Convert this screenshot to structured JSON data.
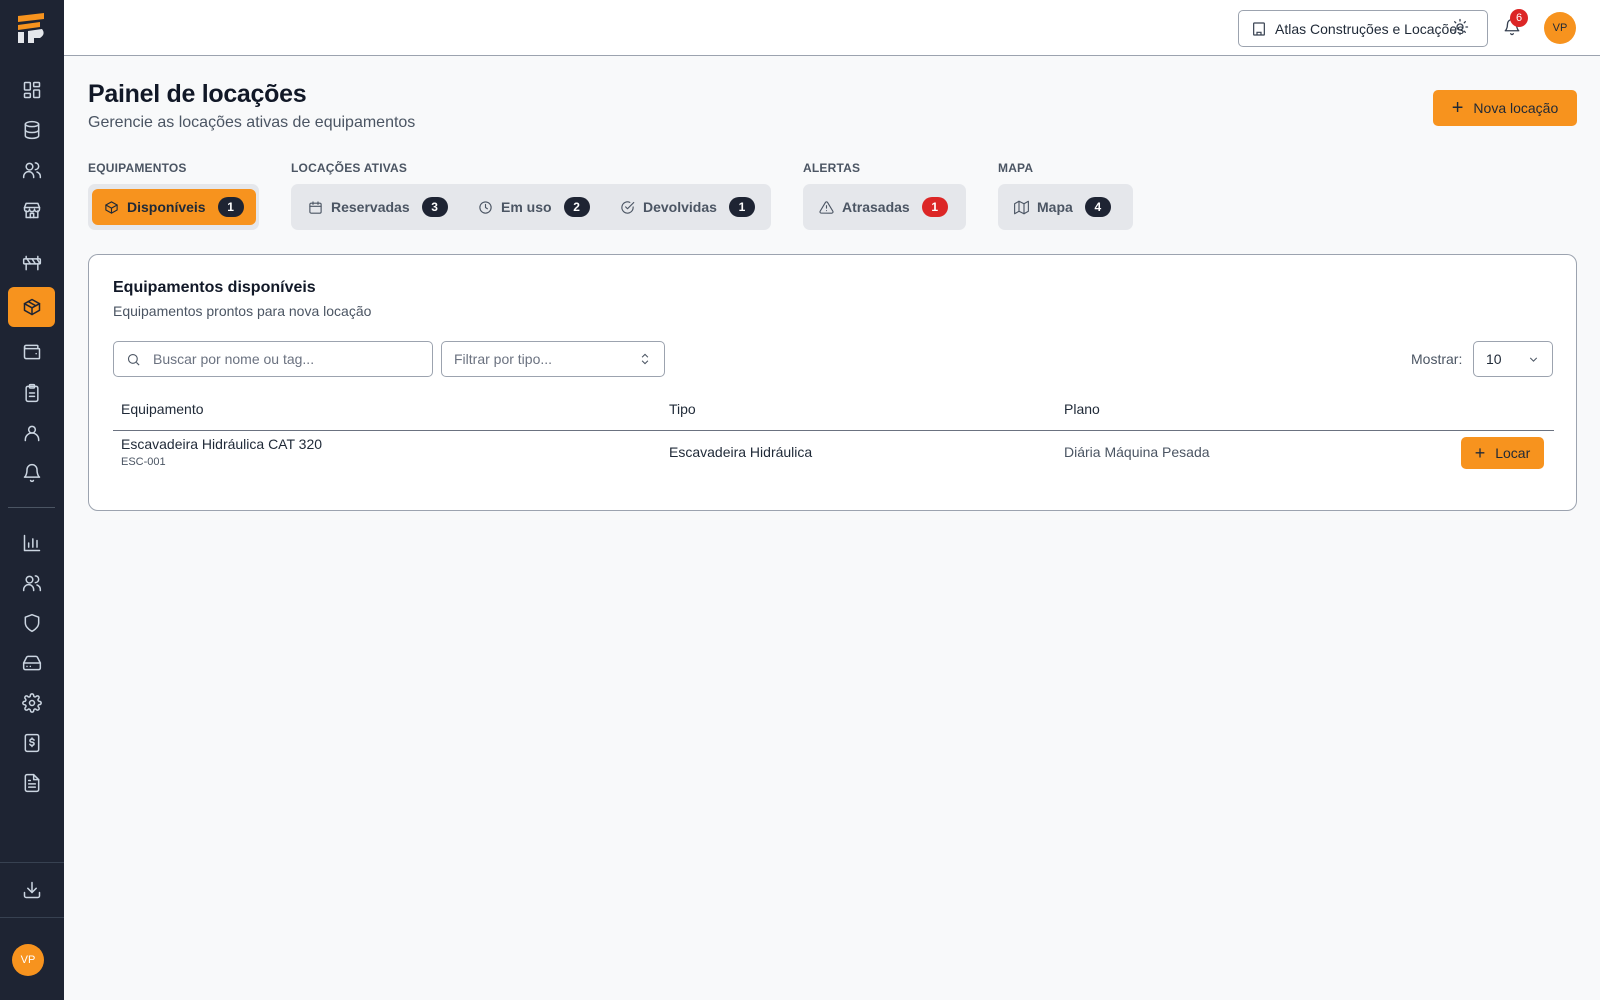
{
  "app": {
    "brand_icon": "logo-icon"
  },
  "topbar": {
    "company": "Atlas Construções e Locações",
    "notifications_count": "6",
    "user_initials": "VP"
  },
  "sidebar": {
    "user_initials": "VP",
    "items": [
      {
        "icon": "dashboard-icon"
      },
      {
        "icon": "database-icon"
      },
      {
        "icon": "users-icon"
      },
      {
        "icon": "store-icon"
      },
      {
        "icon": "barrier-icon"
      },
      {
        "icon": "box-icon",
        "active": true
      },
      {
        "icon": "wallet-icon"
      },
      {
        "icon": "clipboard-icon"
      },
      {
        "icon": "user-icon"
      },
      {
        "icon": "bell-icon"
      },
      {
        "icon": "bar-chart-icon"
      },
      {
        "icon": "users-icon"
      },
      {
        "icon": "shield-icon"
      },
      {
        "icon": "drive-icon"
      },
      {
        "icon": "gear-icon"
      },
      {
        "icon": "receipt-icon"
      },
      {
        "icon": "document-icon"
      },
      {
        "icon": "download-icon"
      }
    ]
  },
  "page": {
    "title": "Painel de locações",
    "subtitle": "Gerencie as locações ativas de equipamentos",
    "new_button": "Nova locação"
  },
  "filters": {
    "groups": [
      {
        "label": "EQUIPAMENTOS"
      },
      {
        "label": "LOCAÇÕES ATIVAS"
      },
      {
        "label": "ALERTAS"
      },
      {
        "label": "MAPA"
      }
    ],
    "pills": [
      {
        "label": "Disponíveis",
        "count": "1",
        "icon": "box-icon",
        "active": true
      },
      {
        "label": "Reservadas",
        "count": "3",
        "icon": "calendar-icon"
      },
      {
        "label": "Em uso",
        "count": "2",
        "icon": "clock-icon"
      },
      {
        "label": "Devolvidas",
        "count": "1",
        "icon": "check-circle-icon"
      },
      {
        "label": "Atrasadas",
        "count": "1",
        "icon": "warning-icon"
      },
      {
        "label": "Mapa",
        "count": "4",
        "icon": "map-icon"
      }
    ]
  },
  "card": {
    "title": "Equipamentos disponíveis",
    "subtitle": "Equipamentos prontos para nova locação",
    "search_placeholder": "Buscar por nome ou tag...",
    "type_filter_placeholder": "Filtrar por tipo...",
    "show_label": "Mostrar:",
    "show_value": "10",
    "columns": [
      "Equipamento",
      "Tipo",
      "Plano"
    ],
    "rows": [
      {
        "name": "Escavadeira Hidráulica CAT 320",
        "tag": "ESC-001",
        "type": "Escavadeira Hidráulica",
        "plan": "Diária Máquina Pesada",
        "action": "Locar"
      }
    ]
  },
  "colors": {
    "accent": "#f7931e",
    "sidebar": "#1e2433",
    "danger": "#dc2626"
  }
}
